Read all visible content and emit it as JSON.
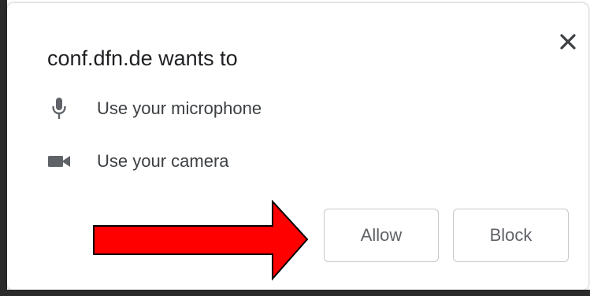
{
  "dialog": {
    "title": "conf.dfn.de wants to",
    "close_icon": "close-icon",
    "permissions": [
      {
        "icon": "microphone-icon",
        "label": "Use your microphone"
      },
      {
        "icon": "camera-icon",
        "label": "Use your camera"
      }
    ],
    "buttons": {
      "allow_label": "Allow",
      "block_label": "Block"
    }
  },
  "annotation": {
    "arrow_icon": "arrow-right-icon",
    "arrow_fill": "#ff0000",
    "arrow_stroke": "#000000"
  },
  "colors": {
    "title_text": "#202124",
    "label_text": "#3c4043",
    "button_text": "#5f6368",
    "icon": "#5f6368",
    "button_border": "#c7c7c7",
    "frame": "#2b2b2b"
  }
}
